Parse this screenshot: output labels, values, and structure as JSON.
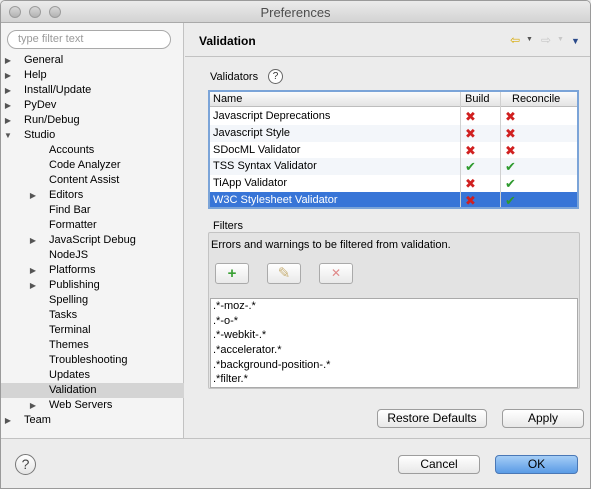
{
  "window": {
    "title": "Preferences"
  },
  "sidebar": {
    "filter_placeholder": "type filter text",
    "items": [
      {
        "label": "General",
        "level": 0,
        "expander": "closed"
      },
      {
        "label": "Help",
        "level": 0,
        "expander": "closed"
      },
      {
        "label": "Install/Update",
        "level": 0,
        "expander": "closed"
      },
      {
        "label": "PyDev",
        "level": 0,
        "expander": "closed"
      },
      {
        "label": "Run/Debug",
        "level": 0,
        "expander": "closed"
      },
      {
        "label": "Studio",
        "level": 0,
        "expander": "open"
      },
      {
        "label": "Accounts",
        "level": 1,
        "expander": "none"
      },
      {
        "label": "Code Analyzer",
        "level": 1,
        "expander": "none"
      },
      {
        "label": "Content Assist",
        "level": 1,
        "expander": "none"
      },
      {
        "label": "Editors",
        "level": 1,
        "expander": "closed"
      },
      {
        "label": "Find Bar",
        "level": 1,
        "expander": "none"
      },
      {
        "label": "Formatter",
        "level": 1,
        "expander": "none"
      },
      {
        "label": "JavaScript Debug",
        "level": 1,
        "expander": "closed"
      },
      {
        "label": "NodeJS",
        "level": 1,
        "expander": "none"
      },
      {
        "label": "Platforms",
        "level": 1,
        "expander": "closed"
      },
      {
        "label": "Publishing",
        "level": 1,
        "expander": "closed"
      },
      {
        "label": "Spelling",
        "level": 1,
        "expander": "none"
      },
      {
        "label": "Tasks",
        "level": 1,
        "expander": "none"
      },
      {
        "label": "Terminal",
        "level": 1,
        "expander": "none"
      },
      {
        "label": "Themes",
        "level": 1,
        "expander": "none"
      },
      {
        "label": "Troubleshooting",
        "level": 1,
        "expander": "none"
      },
      {
        "label": "Updates",
        "level": 1,
        "expander": "none"
      },
      {
        "label": "Validation",
        "level": 1,
        "expander": "none",
        "selected": true
      },
      {
        "label": "Web Servers",
        "level": 1,
        "expander": "closed"
      },
      {
        "label": "Team",
        "level": 0,
        "expander": "closed"
      }
    ]
  },
  "page": {
    "title": "Validation",
    "validators_label": "Validators",
    "filters_label": "Filters",
    "filters_description": "Errors and warnings to be filtered from validation."
  },
  "validators": {
    "columns": [
      "Name",
      "Build",
      "Reconcile"
    ],
    "rows": [
      {
        "name": "Javascript Deprecations",
        "build": "x",
        "reconcile": "x"
      },
      {
        "name": "Javascript Style",
        "build": "x",
        "reconcile": "x"
      },
      {
        "name": "SDocML Validator",
        "build": "x",
        "reconcile": "x"
      },
      {
        "name": "TSS Syntax Validator",
        "build": "check",
        "reconcile": "check"
      },
      {
        "name": "TiApp Validator",
        "build": "x",
        "reconcile": "check"
      },
      {
        "name": "W3C Stylesheet Validator",
        "build": "x",
        "reconcile": "check",
        "selected": true
      }
    ]
  },
  "filters": [
    ".*-moz-.*",
    ".*-o-*",
    ".*-webkit-.*",
    ".*accelerator.*",
    ".*background-position-.*",
    ".*filter.*"
  ],
  "icons": {
    "add": "+",
    "edit": "✎",
    "remove": "✕",
    "check": "✔",
    "x": "✖",
    "back": "⇦",
    "forward": "⇨",
    "help": "?"
  },
  "buttons": {
    "restore_defaults": "Restore Defaults",
    "apply": "Apply",
    "cancel": "Cancel",
    "ok": "OK"
  },
  "colors": {
    "selection": "#3875d7",
    "error_icon": "#d02020",
    "ok_icon": "#2e9a2e"
  }
}
